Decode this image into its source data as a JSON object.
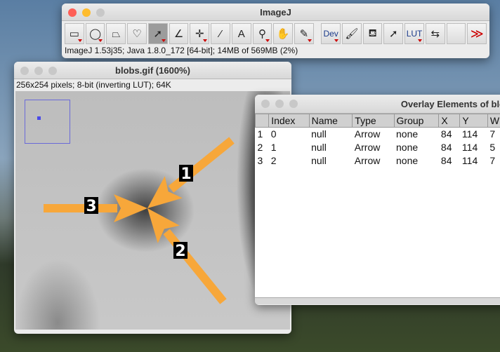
{
  "imagej": {
    "title": "ImageJ",
    "status": "ImageJ 1.53j35; Java 1.8.0_172 [64-bit]; 14MB of 569MB (2%)",
    "tools": [
      {
        "name": "rectangle",
        "glyph": "▭",
        "dd": true
      },
      {
        "name": "oval",
        "glyph": "◯",
        "dd": true
      },
      {
        "name": "polygon",
        "glyph": "⏢",
        "dd": false
      },
      {
        "name": "freehand",
        "glyph": "♡",
        "dd": false
      },
      {
        "name": "arrow-line",
        "glyph": "➚",
        "dd": true,
        "sel": true
      },
      {
        "name": "angle",
        "glyph": "∠",
        "dd": false
      },
      {
        "name": "point",
        "glyph": "✛",
        "dd": true
      },
      {
        "name": "wand",
        "glyph": "⁄",
        "dd": false
      },
      {
        "name": "text",
        "glyph": "A",
        "dd": false
      },
      {
        "name": "magnifier",
        "glyph": "⚲",
        "dd": true
      },
      {
        "name": "hand",
        "glyph": "✋",
        "dd": false
      },
      {
        "name": "color-picker",
        "glyph": "✎",
        "dd": true
      }
    ],
    "tools2": [
      {
        "name": "dev",
        "glyph": "Dev",
        "dd": true
      },
      {
        "name": "brush",
        "glyph": "🖌",
        "dd": false
      },
      {
        "name": "flood-fill",
        "glyph": "⛾",
        "dd": false
      },
      {
        "name": "arrow-tool",
        "glyph": "➚",
        "dd": false
      },
      {
        "name": "lut",
        "glyph": "LUT",
        "dd": true
      },
      {
        "name": "sync",
        "glyph": "⇆",
        "dd": false
      },
      {
        "name": "empty",
        "glyph": "",
        "dd": false
      },
      {
        "name": "more",
        "glyph": "≫",
        "dd": false
      }
    ]
  },
  "blobs": {
    "title": "blobs.gif (1600%)",
    "info": "256x254 pixels; 8-bit (inverting LUT); 64K",
    "labels": [
      "1",
      "2",
      "3"
    ],
    "arrow_color": "#f7a73a"
  },
  "overlay": {
    "title": "Overlay Elements of blo",
    "columns": [
      "",
      "Index",
      "Name",
      "Type",
      "Group",
      "X",
      "Y",
      "W"
    ],
    "rows": [
      [
        "1",
        "0",
        "null",
        "Arrow",
        "none",
        "84",
        "114",
        "7"
      ],
      [
        "2",
        "1",
        "null",
        "Arrow",
        "none",
        "84",
        "114",
        "5"
      ],
      [
        "3",
        "2",
        "null",
        "Arrow",
        "none",
        "84",
        "114",
        "7"
      ]
    ]
  }
}
